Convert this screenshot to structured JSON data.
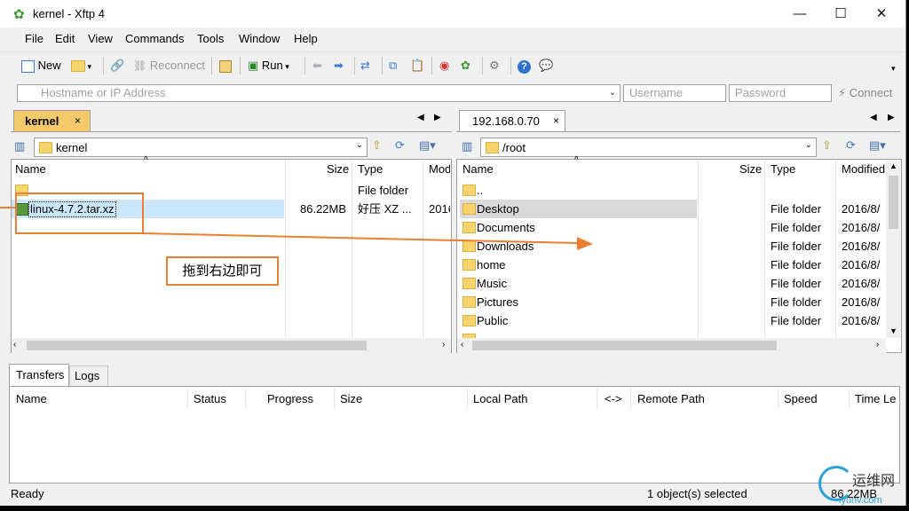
{
  "window": {
    "title": "kernel - Xftp 4"
  },
  "menu": [
    "File",
    "Edit",
    "View",
    "Commands",
    "Tools",
    "Window",
    "Help"
  ],
  "toolbar": {
    "new_label": "New",
    "reconnect_label": "Reconnect",
    "run_label": "Run"
  },
  "address": {
    "host_placeholder": "Hostname or IP Address",
    "user_placeholder": "Username",
    "pass_placeholder": "Password",
    "connect_label": "Connect"
  },
  "left": {
    "tab": "kernel",
    "tab_close": "×",
    "path": "kernel",
    "columns": [
      "Name",
      "Size",
      "Type",
      "Mod"
    ],
    "rows": [
      {
        "name": "",
        "size": "",
        "type": "File folder",
        "mod": ""
      },
      {
        "name": "linux-4.7.2.tar.xz",
        "size": "86.22MB",
        "type": "好压 XZ ...",
        "mod": "2016"
      }
    ]
  },
  "right": {
    "tab": "192.168.0.70",
    "tab_close": "×",
    "path": "/root",
    "columns": [
      "Name",
      "Size",
      "Type",
      "Modified"
    ],
    "rows": [
      {
        "name": "..",
        "type": "",
        "mod": ""
      },
      {
        "name": "Desktop",
        "type": "File folder",
        "mod": "2016/8/"
      },
      {
        "name": "Documents",
        "type": "File folder",
        "mod": "2016/8/"
      },
      {
        "name": "Downloads",
        "type": "File folder",
        "mod": "2016/8/"
      },
      {
        "name": "home",
        "type": "File folder",
        "mod": "2016/8/"
      },
      {
        "name": "Music",
        "type": "File folder",
        "mod": "2016/8/"
      },
      {
        "name": "Pictures",
        "type": "File folder",
        "mod": "2016/8/"
      },
      {
        "name": "Public",
        "type": "File folder",
        "mod": "2016/8/"
      }
    ]
  },
  "annotation": {
    "text": "拖到右边即可",
    "color": "#ed7d31"
  },
  "bottom": {
    "tabs": [
      "Transfers",
      "Logs"
    ],
    "columns": [
      "Name",
      "Status",
      "Progress",
      "Size",
      "Local Path",
      "<->",
      "Remote Path",
      "Speed",
      "Time Le"
    ]
  },
  "status": {
    "left": "Ready",
    "selection": "1 object(s) selected",
    "size": "86.22MB"
  },
  "watermark": {
    "text": "运维网",
    "sub": "iyunv.com"
  }
}
